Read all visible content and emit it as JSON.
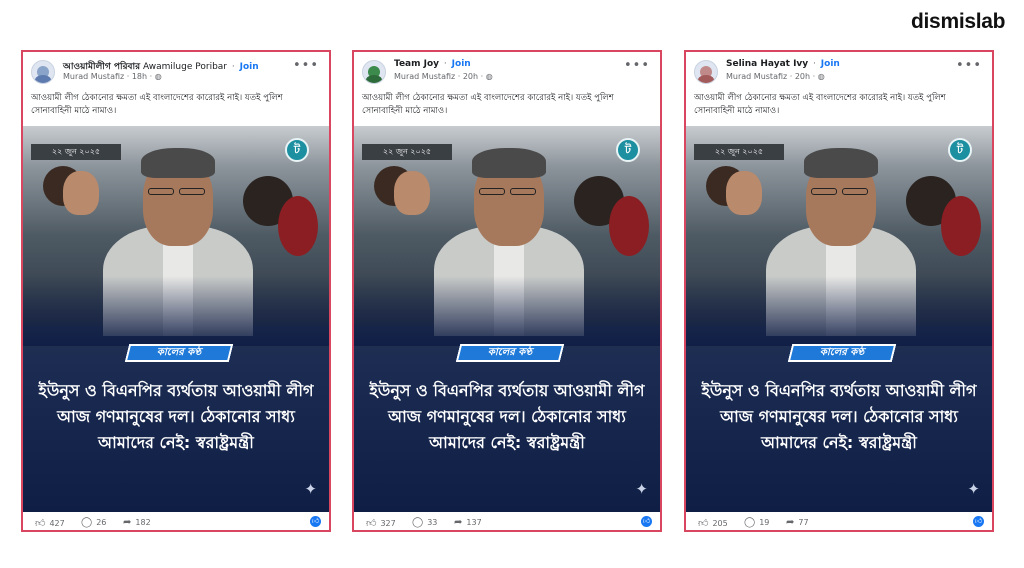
{
  "brand": "dismislab",
  "posts": [
    {
      "page_name": "আওয়ামীলীগ পরিবার",
      "page_name_alt": "Awamiluge Poribar",
      "join": "Join",
      "author": "Murad Mustafiz",
      "time": "18h",
      "caption": "আওয়ামী লীগ ঠেকানোর ক্ষমতা এই বাংলাদেশের কারোরই নাই। যতই পুলিশ সোনাবাহিনী মাঠে নামাও।",
      "date_stamp": "২২ জুন ২০২৫",
      "source_logo": "কালের কণ্ঠ",
      "headline": "ইউনুস ও বিএনপির ব্যর্থতায় আওয়ামী লীগ আজ গণমানুষের দল। ঠেকানোর সাধ্য আমাদের নেই: স্বরাষ্ট্রমন্ত্রী",
      "likes": "427",
      "comments": "26",
      "shares": "182"
    },
    {
      "page_name": "Team Joy",
      "page_name_alt": "",
      "join": "Join",
      "author": "Murad Mustafiz",
      "time": "20h",
      "caption": "আওয়ামী লীগ ঠেকানোর ক্ষমতা এই বাংলাদেশের কারোরই নাই। যতই পুলিশ সোনাবাহিনী মাঠে নামাও।",
      "date_stamp": "২২ জুন ২০২৫",
      "source_logo": "কালের কণ্ঠ",
      "headline": "ইউনুস ও বিএনপির ব্যর্থতায় আওয়ামী লীগ আজ গণমানুষের দল। ঠেকানোর সাধ্য আমাদের নেই: স্বরাষ্ট্রমন্ত্রী",
      "likes": "327",
      "comments": "33",
      "shares": "137"
    },
    {
      "page_name": "Selina Hayat Ivy",
      "page_name_alt": "",
      "join": "Join",
      "author": "Murad Mustafiz",
      "time": "20h",
      "caption": "আওয়ামী লীগ ঠেকানোর ক্ষমতা এই বাংলাদেশের কারোরই নাই। যতই পুলিশ সোনাবাহিনী মাঠে নামাও।",
      "date_stamp": "২২ জুন ২০২৫",
      "source_logo": "কালের কণ্ঠ",
      "headline": "ইউনুস ও বিএনপির ব্যর্থতায় আওয়ামী লীগ আজ গণমানুষের দল। ঠেকানোর সাধ্য আমাদের নেই: স্বরাষ্ট্রমন্ত্রী",
      "likes": "205",
      "comments": "19",
      "shares": "77"
    }
  ],
  "colors": {
    "card_border": "#d9465f",
    "join_link": "#1877f2",
    "headline_bg": "#0f1e45",
    "source_badge": "#1f79d8"
  },
  "icons": {
    "more": "more-options-icon",
    "like": "like-icon",
    "comment": "comment-icon",
    "share": "share-icon",
    "globe": "globe-icon",
    "reaction": "like-reaction-icon",
    "sparkle": "sparkle-icon"
  }
}
